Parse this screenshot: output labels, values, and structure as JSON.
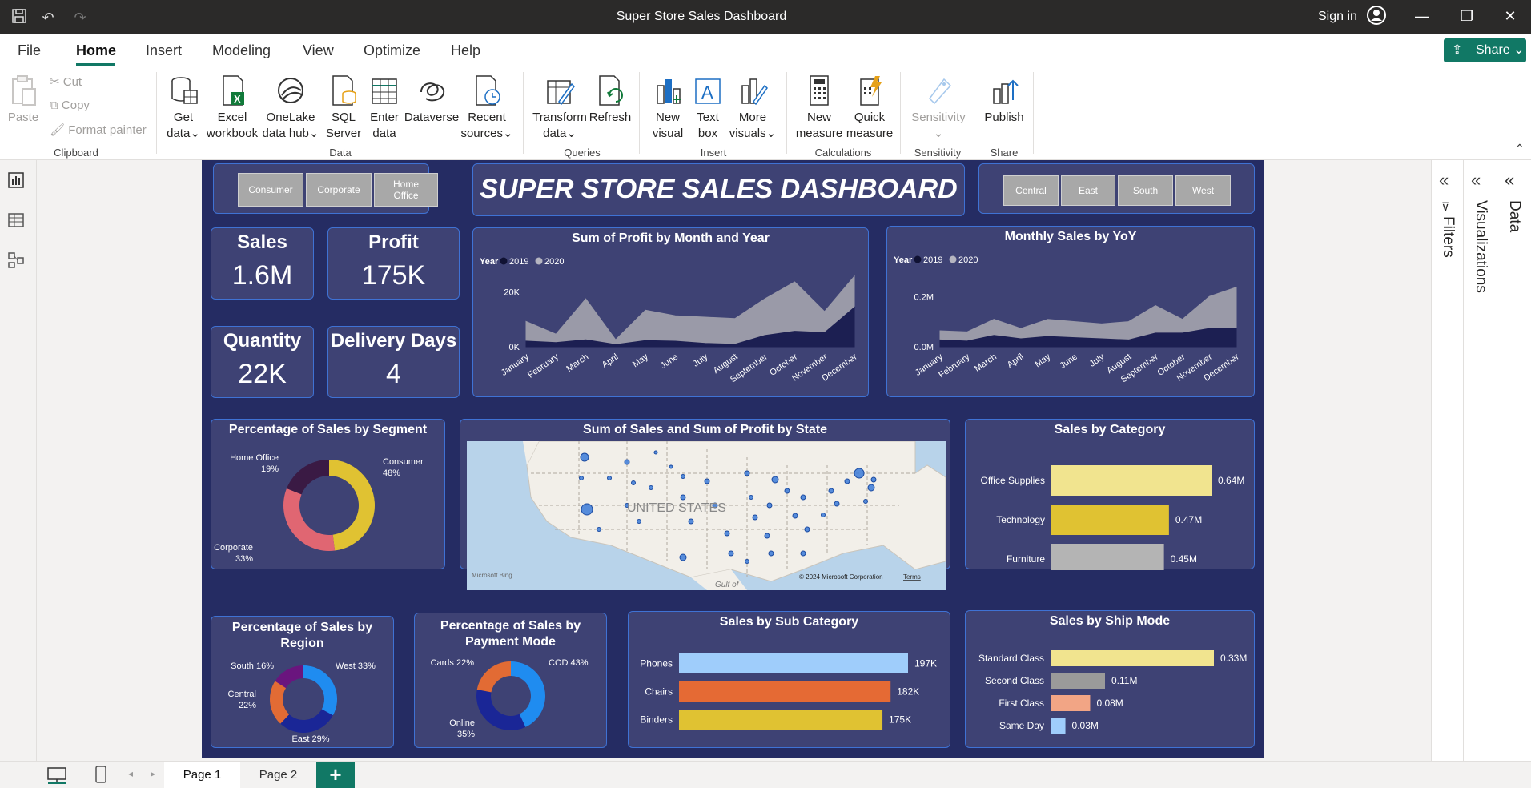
{
  "titlebar": {
    "title": "Super Store Sales Dashboard",
    "signin": "Sign in"
  },
  "menu": {
    "tabs": [
      "File",
      "Home",
      "Insert",
      "Modeling",
      "View",
      "Optimize",
      "Help"
    ],
    "share": "Share"
  },
  "ribbon": {
    "clipboard": {
      "paste": "Paste",
      "cut": "Cut",
      "copy": "Copy",
      "format_painter": "Format painter",
      "label": "Clipboard"
    },
    "data": {
      "get_data": [
        "Get",
        "data"
      ],
      "excel": [
        "Excel",
        "workbook"
      ],
      "onelake": [
        "OneLake",
        "data hub"
      ],
      "sql": [
        "SQL",
        "Server"
      ],
      "enter": [
        "Enter",
        "data"
      ],
      "dataverse": "Dataverse",
      "recent": [
        "Recent",
        "sources"
      ],
      "label": "Data"
    },
    "queries": {
      "transform": [
        "Transform",
        "data"
      ],
      "refresh": "Refresh",
      "label": "Queries"
    },
    "insert": {
      "new_visual": [
        "New",
        "visual"
      ],
      "text_box": [
        "Text",
        "box"
      ],
      "more_visuals": [
        "More",
        "visuals"
      ],
      "label": "Insert"
    },
    "calculations": {
      "new_measure": [
        "New",
        "measure"
      ],
      "quick_measure": [
        "Quick",
        "measure"
      ],
      "label": "Calculations"
    },
    "sensitivity": {
      "btn": "Sensitivity",
      "label": "Sensitivity"
    },
    "share": {
      "publish": "Publish",
      "label": "Share"
    }
  },
  "panes": {
    "filters": "Filters",
    "visualizations": "Visualizations",
    "data": "Data"
  },
  "pages": {
    "page1": "Page 1",
    "page2": "Page 2"
  },
  "dashboard": {
    "title": "SUPER STORE SALES DASHBOARD",
    "segment_slicer": [
      "Consumer",
      "Corporate",
      "Home Office"
    ],
    "region_slicer": [
      "Central",
      "East",
      "South",
      "West"
    ],
    "kpis": [
      {
        "label": "Sales",
        "value": "1.6M"
      },
      {
        "label": "Profit",
        "value": "175K"
      },
      {
        "label": "Quantity",
        "value": "22K"
      },
      {
        "label": "Delivery Days",
        "value": "4"
      }
    ],
    "map": {
      "title": "Sum of Sales and Sum of Profit by State",
      "country_label": "UNITED STATES",
      "gulf_label": "Gulf of",
      "credit": "© 2024 Microsoft Corporation",
      "terms": "Terms",
      "bing": "Microsoft Bing"
    }
  },
  "colors": {
    "canvas": "#252c63",
    "card": "#3e4274",
    "border": "#3f72d4",
    "accent": "#117865",
    "y2019": "#1c1f52",
    "y2020": "#9a9aa8"
  },
  "chart_data": [
    {
      "id": "profit_month",
      "type": "area",
      "title": "Sum of Profit by Month and Year",
      "legend_title": "Year",
      "categories": [
        "January",
        "February",
        "March",
        "April",
        "May",
        "June",
        "July",
        "August",
        "September",
        "October",
        "November",
        "December"
      ],
      "series": [
        {
          "name": "2019",
          "values": [
            2000,
            1500,
            2500,
            800,
            2200,
            2000,
            1200,
            900,
            4000,
            5500,
            5000,
            14000
          ]
        },
        {
          "name": "2020",
          "values": [
            9000,
            4500,
            17000,
            2500,
            13000,
            11000,
            10500,
            10000,
            17000,
            23000,
            12500,
            25000
          ]
        }
      ],
      "ylim": [
        0,
        25000
      ],
      "yticks": [
        "0K",
        "20K"
      ]
    },
    {
      "id": "sales_yoy",
      "type": "area",
      "title": "Monthly Sales by YoY",
      "legend_title": "Year",
      "categories": [
        "January",
        "February",
        "March",
        "April",
        "May",
        "June",
        "July",
        "August",
        "September",
        "October",
        "November",
        "December"
      ],
      "series": [
        {
          "name": "2019",
          "values": [
            0.03,
            0.025,
            0.05,
            0.035,
            0.045,
            0.04,
            0.035,
            0.03,
            0.06,
            0.06,
            0.08,
            0.08
          ]
        },
        {
          "name": "2020",
          "values": [
            0.07,
            0.065,
            0.12,
            0.08,
            0.12,
            0.11,
            0.1,
            0.11,
            0.18,
            0.12,
            0.22,
            0.26
          ]
        }
      ],
      "ylim": [
        0,
        0.28
      ],
      "yticks": [
        "0.0M",
        "0.2M"
      ]
    },
    {
      "id": "segment_pct",
      "type": "pie",
      "title": "Percentage of Sales by Segment",
      "labels": [
        "Consumer",
        "Corporate",
        "Home Office"
      ],
      "values": [
        48,
        33,
        19
      ],
      "display": [
        "48%",
        "33%",
        "19%"
      ],
      "colors": [
        "#e0c232",
        "#e06672",
        "#3a1a44"
      ]
    },
    {
      "id": "category_sales",
      "type": "bar",
      "title": "Sales by Category",
      "categories": [
        "Office Supplies",
        "Technology",
        "Furniture"
      ],
      "values": [
        0.64,
        0.47,
        0.45
      ],
      "labels": [
        "0.64M",
        "0.47M",
        "0.45M"
      ],
      "colors": [
        "#f1e48f",
        "#e0c232",
        "#b4b4b4"
      ]
    },
    {
      "id": "region_pct",
      "type": "pie",
      "title": "Percentage of Sales by Region",
      "labels": [
        "West",
        "East",
        "Central",
        "South"
      ],
      "values": [
        33,
        29,
        22,
        16
      ],
      "display": [
        "33%",
        "29%",
        "22%",
        "16%"
      ],
      "colors": [
        "#1f8cf0",
        "#1a2696",
        "#e26b34",
        "#6a157e"
      ]
    },
    {
      "id": "payment_pct",
      "type": "pie",
      "title": "Percentage of Sales by Payment Mode",
      "labels": [
        "COD",
        "Online",
        "Cards"
      ],
      "values": [
        43,
        35,
        22
      ],
      "display": [
        "43%",
        "35%",
        "22%"
      ],
      "colors": [
        "#1f8cf0",
        "#1a2696",
        "#e26b34"
      ]
    },
    {
      "id": "subcategory_sales",
      "type": "bar",
      "title": "Sales by Sub Category",
      "categories": [
        "Phones",
        "Chairs",
        "Binders"
      ],
      "values": [
        197,
        182,
        175
      ],
      "labels": [
        "197K",
        "182K",
        "175K"
      ],
      "colors": [
        "#9fcdfb",
        "#e56a34",
        "#e0c232"
      ]
    },
    {
      "id": "shipmode_sales",
      "type": "bar",
      "title": "Sales by Ship Mode",
      "categories": [
        "Standard Class",
        "Second Class",
        "First Class",
        "Same Day"
      ],
      "values": [
        0.33,
        0.11,
        0.08,
        0.03
      ],
      "labels": [
        "0.33M",
        "0.11M",
        "0.08M",
        "0.03M"
      ],
      "colors": [
        "#f1e48f",
        "#9a9a9a",
        "#f2a585",
        "#9fcdfb"
      ]
    }
  ]
}
